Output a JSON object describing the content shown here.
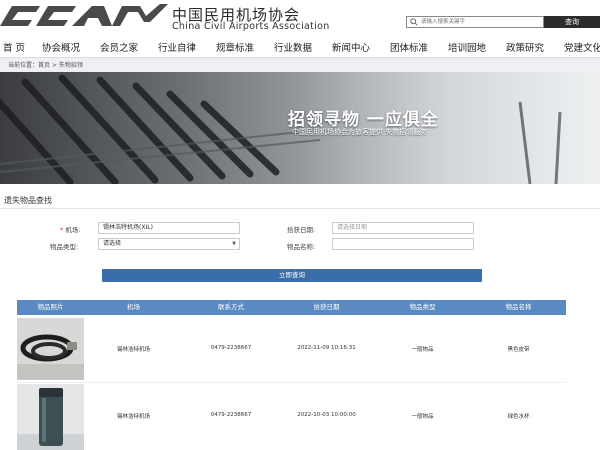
{
  "header": {
    "logo_cn": "中国民用机场协会",
    "logo_en": "China Civil Airports Association",
    "search_placeholder": "请输入搜索关键字",
    "search_button": "查询"
  },
  "nav": {
    "items": [
      "首 页",
      "协会概况",
      "会员之家",
      "行业自律",
      "规章标准",
      "行业数据",
      "新闻中心",
      "团体标准",
      "培训园地",
      "政策研究",
      "党建文化"
    ]
  },
  "breadcrumb": "当前位置：首页 > 失物招领",
  "banner": {
    "title": "招领寻物 一应俱全",
    "subtitle": "中国民用机场协会为旅客提供 失物招领服务"
  },
  "search_section": {
    "title": "遗失物品查找",
    "required_mark": "*",
    "airport_label": "机场:",
    "airport_value": "锡林浩特机场(XIL)",
    "date_label": "拾获日期:",
    "date_placeholder": "请选择日期",
    "type_label": "物品类型:",
    "type_value": "请选择",
    "name_label": "物品名称:",
    "name_value": "",
    "submit_label": "立即查询"
  },
  "table": {
    "headers": [
      "物品照片",
      "机场",
      "联系方式",
      "拾获日期",
      "物品类型",
      "物品名称"
    ],
    "rows": [
      {
        "airport": "锡林浩特机场",
        "phone": "0479-2238667",
        "date": "2022-11-09 10:16:31",
        "type": "一般物品",
        "name": "黑色皮带"
      },
      {
        "airport": "锡林浩特机场",
        "phone": "0479-2238667",
        "date": "2022-10-03 10:00:00",
        "type": "一般物品",
        "name": "绿色水杯"
      }
    ]
  },
  "colors": {
    "table_header": "#5b8ac2",
    "button": "#3a6ea8",
    "search_button": "#2c2c2c"
  }
}
